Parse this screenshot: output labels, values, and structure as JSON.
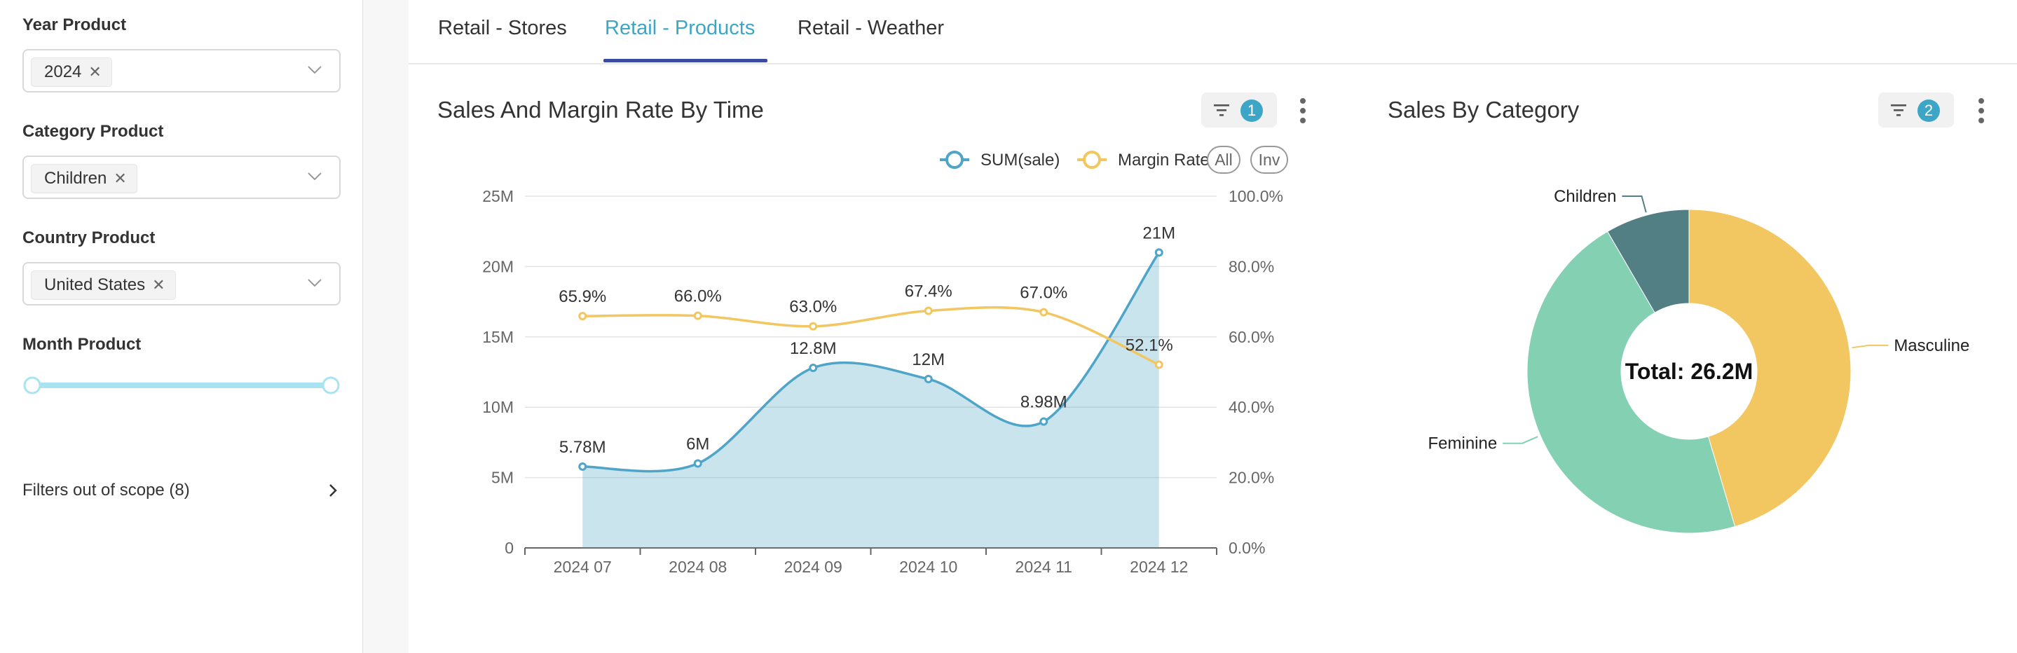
{
  "sidebar": {
    "filters": [
      {
        "label": "Year Product",
        "value": "2024"
      },
      {
        "label": "Category Product",
        "value": "Children"
      },
      {
        "label": "Country Product",
        "value": "United States"
      }
    ],
    "month_label": "Month Product",
    "month_range": [
      0,
      1
    ],
    "out_of_scope": "Filters out of scope (8)"
  },
  "tabs": [
    {
      "label": "Retail - Stores",
      "active": false
    },
    {
      "label": "Retail - Products",
      "active": true
    },
    {
      "label": "Retail - Weather",
      "active": false
    }
  ],
  "cards": {
    "left": {
      "title": "Sales And Margin Rate By Time",
      "filter_count": "1"
    },
    "right": {
      "title": "Sales By Category",
      "filter_count": "2"
    }
  },
  "colors": {
    "accent": "#3da6c7",
    "sales": "#4ea5c8",
    "margin": "#f2c661",
    "tab_underline": "#3b4ba0"
  },
  "chart_data": [
    {
      "type": "line",
      "categories": [
        "2024 07",
        "2024 08",
        "2024 09",
        "2024 10",
        "2024 11",
        "2024 12"
      ],
      "legend": {
        "items": [
          "SUM(sale)",
          "Margin Rate"
        ],
        "buttons": [
          "All",
          "Inv"
        ],
        "placement": "top-right"
      },
      "series": [
        {
          "name": "SUM(sale)",
          "kind": "area",
          "axis": "left",
          "color": "#4ea5c8",
          "values": [
            5780000,
            6000000,
            12800000,
            12000000,
            8980000,
            21000000
          ],
          "labels": [
            "5.78M",
            "6M",
            "12.8M",
            "12M",
            "8.98M",
            "21M"
          ]
        },
        {
          "name": "Margin Rate",
          "kind": "line",
          "axis": "right",
          "color": "#f2c661",
          "values": [
            65.9,
            66.0,
            63.0,
            67.4,
            67.0,
            52.1
          ],
          "labels": [
            "65.9%",
            "66.0%",
            "63.0%",
            "67.4%",
            "67.0%",
            "52.1%"
          ]
        }
      ],
      "y_left": {
        "min": 0,
        "max": 25000000,
        "ticks": [
          "0",
          "5M",
          "10M",
          "15M",
          "20M",
          "25M"
        ]
      },
      "y_right": {
        "min": 0,
        "max": 100,
        "ticks": [
          "0.0%",
          "20.0%",
          "40.0%",
          "60.0%",
          "80.0%",
          "100.0%"
        ]
      },
      "grid": true
    },
    {
      "type": "pie",
      "style": "donut",
      "center_label": "Total: 26.2M",
      "slices": [
        {
          "label": "Masculine",
          "value": 11.9,
          "color": "#f2c661"
        },
        {
          "label": "Feminine",
          "value": 12.1,
          "color": "#84d0b3"
        },
        {
          "label": "Children",
          "value": 2.2,
          "color": "#517f83"
        }
      ]
    }
  ]
}
